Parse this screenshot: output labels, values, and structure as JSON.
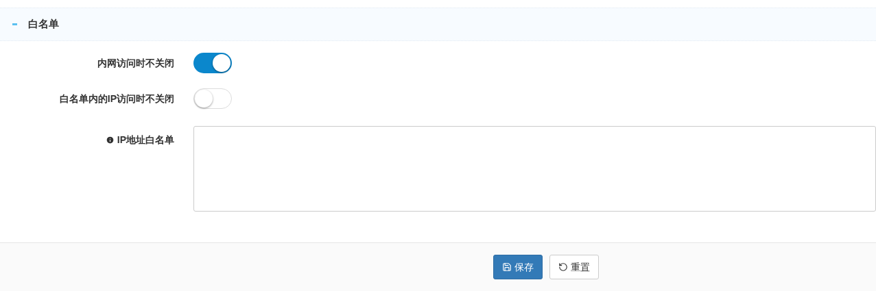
{
  "section": {
    "title": "白名单",
    "expanded": true
  },
  "fields": [
    {
      "kind": "switch",
      "label": "内网访问时不关闭",
      "on": true
    },
    {
      "kind": "switch",
      "label": "白名单内的IP访问时不关闭",
      "on": false
    },
    {
      "kind": "textarea",
      "label": "IP地址白名单"
    }
  ],
  "buttons": [
    {
      "kind": "save",
      "label": "保存"
    },
    {
      "kind": "reset",
      "label": "重置"
    }
  ]
}
